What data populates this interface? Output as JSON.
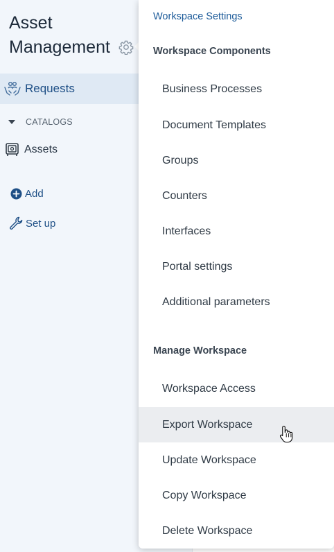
{
  "sidebar": {
    "workspace_title": "Asset Management",
    "workspace_gear_icon": "gear-icon",
    "nav": {
      "requests": {
        "label": "Requests",
        "icon": "hands-people-icon"
      },
      "catalogs": {
        "label": "CATALOGS",
        "icon": "caret-down-icon"
      },
      "assets": {
        "label": "Assets",
        "icon": "safe-icon"
      }
    },
    "add": {
      "label": "Add",
      "icon": "plus-circle-icon"
    },
    "setup": {
      "label": "Set up",
      "icon": "wrench-icon"
    }
  },
  "dropdown": {
    "header": "Workspace Settings",
    "sections": [
      {
        "title": "Workspace Components",
        "items": [
          "Business Processes",
          "Document Templates",
          "Groups",
          "Counters",
          "Interfaces",
          "Portal settings",
          "Additional parameters"
        ]
      },
      {
        "title": "Manage Workspace",
        "items": [
          "Workspace Access",
          "Export Workspace",
          "Update Workspace",
          "Copy Workspace",
          "Delete Workspace"
        ]
      }
    ],
    "hovered_item": "Export Workspace"
  },
  "colors": {
    "accent": "#1e4f86",
    "sidebar_bg": "#f2f6fb",
    "active_nav_bg": "#dfe9f4",
    "hover_bg": "#ebedf0"
  }
}
